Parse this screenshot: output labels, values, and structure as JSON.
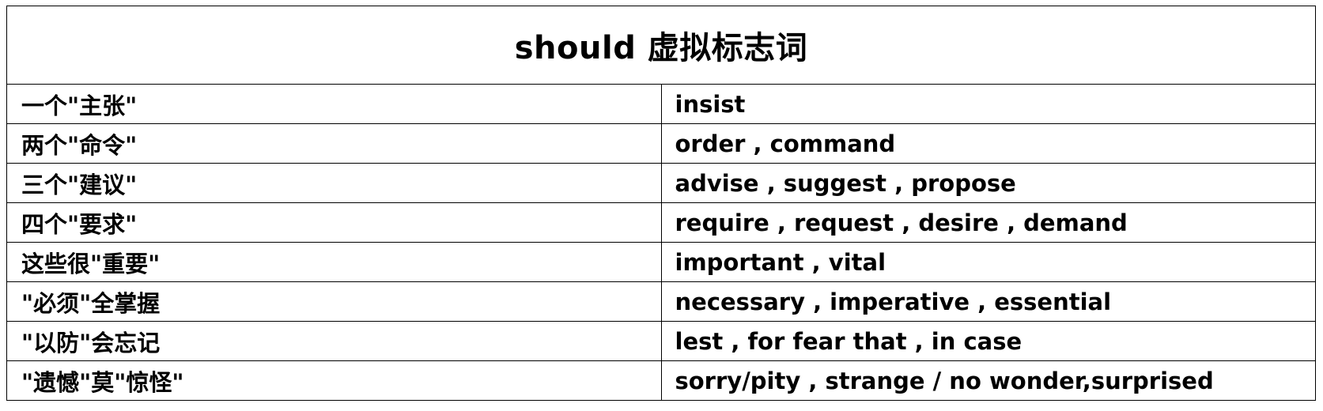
{
  "title": "should 虚拟标志词",
  "rows": [
    {
      "mnemonic": "一个\"主张\"",
      "words": "insist"
    },
    {
      "mnemonic": "两个\"命令\"",
      "words": "order , command"
    },
    {
      "mnemonic": "三个\"建议\"",
      "words": "advise , suggest , propose"
    },
    {
      "mnemonic": "四个\"要求\"",
      "words": "require , request , desire , demand"
    },
    {
      "mnemonic": "这些很\"重要\"",
      "words": "important , vital"
    },
    {
      "mnemonic": "\"必须\"全掌握",
      "words": "necessary , imperative , essential"
    },
    {
      "mnemonic": "\"以防\"会忘记",
      "words": "lest , for fear that , in case"
    },
    {
      "mnemonic": "\"遗憾\"莫\"惊怪\"",
      "words": "sorry/pity , strange / no wonder,surprised"
    }
  ]
}
